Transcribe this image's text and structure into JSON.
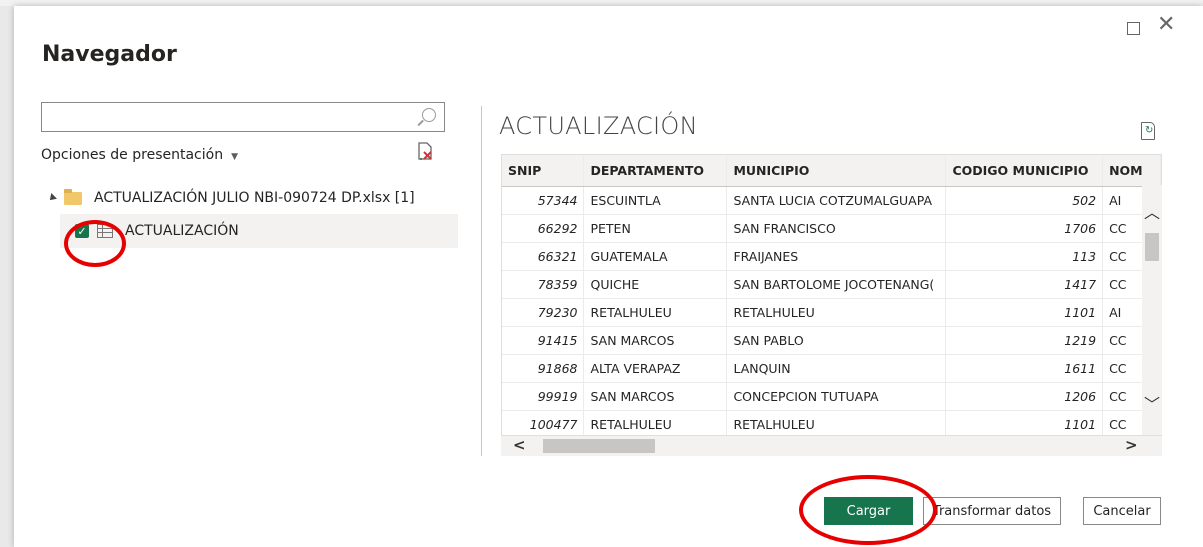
{
  "dialog": {
    "title": "Navegador",
    "search_placeholder": "",
    "display_options_label": "Opciones de presentación"
  },
  "tree": {
    "root_label": "ACTUALIZACIÓN JULIO NBI-090724 DP.xlsx [1]",
    "items": [
      {
        "label": "ACTUALIZACIÓN",
        "checked": true
      }
    ]
  },
  "preview": {
    "title": "ACTUALIZACIÓN",
    "columns": [
      "SNIP",
      "DEPARTAMENTO",
      "MUNICIPIO",
      "CODIGO MUNICIPIO",
      "NOM"
    ],
    "rows": [
      [
        "57344",
        "ESCUINTLA",
        "SANTA LUCIA COTZUMALGUAPA",
        "502",
        "AI"
      ],
      [
        "66292",
        "PETEN",
        "SAN FRANCISCO",
        "1706",
        "CC"
      ],
      [
        "66321",
        "GUATEMALA",
        "FRAIJANES",
        "113",
        "CC"
      ],
      [
        "78359",
        "QUICHE",
        "SAN BARTOLOME JOCOTENANG(",
        "1417",
        "CC"
      ],
      [
        "79230",
        "RETALHULEU",
        "RETALHULEU",
        "1101",
        "AI"
      ],
      [
        "91415",
        "SAN MARCOS",
        "SAN PABLO",
        "1219",
        "CC"
      ],
      [
        "91868",
        "ALTA VERAPAZ",
        "LANQUIN",
        "1611",
        "CC"
      ],
      [
        "99919",
        "SAN MARCOS",
        "CONCEPCION TUTUAPA",
        "1206",
        "CC"
      ],
      [
        "100477",
        "RETALHULEU",
        "RETALHULEU",
        "1101",
        "CC"
      ]
    ]
  },
  "buttons": {
    "load": "Cargar",
    "transform": "Transformar datos",
    "cancel": "Cancelar"
  },
  "colors": {
    "accent": "#16754d",
    "annotation": "#e60000"
  }
}
